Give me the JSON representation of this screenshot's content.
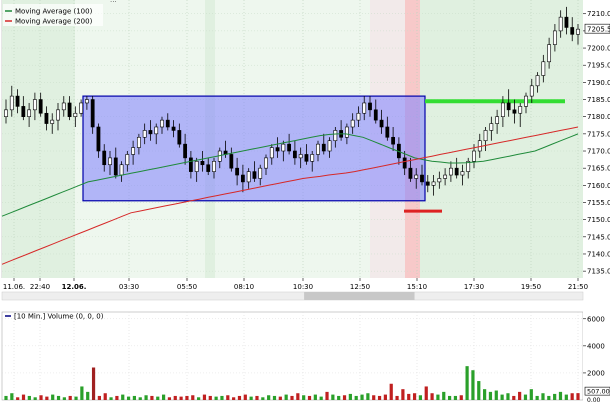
{
  "chart_data": [
    {
      "type": "candlestick",
      "title": "",
      "legend": [
        {
          "label": "Moving Average (100)",
          "color": "#1f8a3a"
        },
        {
          "label": "Moving Average (200)",
          "color": "#d62828"
        }
      ],
      "top_clipped_label": "...",
      "x_tick_labels": [
        "11.06.",
        "22:40",
        "12.06.",
        "03:30",
        "05:50",
        "08:10",
        "10:30",
        "12:50",
        "15:10",
        "17:30",
        "19:50",
        "21:50"
      ],
      "y_tick_labels": [
        "7135.00",
        "7140.00",
        "7145.00",
        "7150.00",
        "7155.00",
        "7160.00",
        "7165.00",
        "7170.00",
        "7175.00",
        "7180.00",
        "7185.00",
        "7190.00",
        "7195.00",
        "7200.00",
        "7205.00",
        "7210.00"
      ],
      "ylim": [
        7133,
        7214
      ],
      "last_price_label": "7205.5",
      "candles": [
        [
          7180,
          7185,
          7178,
          7182
        ],
        [
          7182,
          7189,
          7180,
          7186
        ],
        [
          7186,
          7188,
          7181,
          7183
        ],
        [
          7183,
          7186,
          7179,
          7180
        ],
        [
          7180,
          7184,
          7177,
          7182
        ],
        [
          7182,
          7187,
          7179,
          7185
        ],
        [
          7185,
          7187,
          7180,
          7181
        ],
        [
          7181,
          7183,
          7176,
          7178
        ],
        [
          7178,
          7181,
          7175,
          7179
        ],
        [
          7179,
          7184,
          7176,
          7182
        ],
        [
          7182,
          7186,
          7180,
          7184
        ],
        [
          7184,
          7186,
          7179,
          7180
        ],
        [
          7180,
          7183,
          7177,
          7181
        ],
        [
          7181,
          7185,
          7180,
          7184
        ],
        [
          7184,
          7186,
          7182,
          7185
        ],
        [
          7185,
          7186,
          7175,
          7177
        ],
        [
          7177,
          7178,
          7168,
          7170
        ],
        [
          7170,
          7172,
          7164,
          7166
        ],
        [
          7166,
          7170,
          7163,
          7168
        ],
        [
          7168,
          7171,
          7162,
          7163
        ],
        [
          7163,
          7167,
          7161,
          7166
        ],
        [
          7166,
          7170,
          7164,
          7169
        ],
        [
          7169,
          7173,
          7166,
          7171
        ],
        [
          7171,
          7175,
          7169,
          7174
        ],
        [
          7174,
          7178,
          7172,
          7176
        ],
        [
          7176,
          7179,
          7173,
          7175
        ],
        [
          7175,
          7178,
          7172,
          7177
        ],
        [
          7177,
          7180,
          7175,
          7179
        ],
        [
          7179,
          7181,
          7176,
          7177
        ],
        [
          7177,
          7179,
          7174,
          7176
        ],
        [
          7176,
          7178,
          7171,
          7172
        ],
        [
          7172,
          7175,
          7166,
          7168
        ],
        [
          7168,
          7170,
          7162,
          7164
        ],
        [
          7164,
          7168,
          7161,
          7167
        ],
        [
          7167,
          7170,
          7164,
          7166
        ],
        [
          7166,
          7168,
          7163,
          7164
        ],
        [
          7164,
          7168,
          7162,
          7167
        ],
        [
          7167,
          7171,
          7165,
          7170
        ],
        [
          7170,
          7173,
          7168,
          7169
        ],
        [
          7169,
          7171,
          7164,
          7165
        ],
        [
          7165,
          7168,
          7160,
          7163
        ],
        [
          7163,
          7166,
          7158,
          7161
        ],
        [
          7161,
          7165,
          7159,
          7164
        ],
        [
          7164,
          7167,
          7161,
          7162
        ],
        [
          7162,
          7166,
          7160,
          7165
        ],
        [
          7165,
          7169,
          7163,
          7168
        ],
        [
          7168,
          7172,
          7166,
          7171
        ],
        [
          7171,
          7174,
          7168,
          7170
        ],
        [
          7170,
          7173,
          7167,
          7172
        ],
        [
          7172,
          7175,
          7169,
          7170
        ],
        [
          7170,
          7173,
          7166,
          7168
        ],
        [
          7168,
          7171,
          7165,
          7169
        ],
        [
          7169,
          7172,
          7166,
          7167
        ],
        [
          7167,
          7170,
          7164,
          7169
        ],
        [
          7169,
          7173,
          7167,
          7172
        ],
        [
          7172,
          7175,
          7169,
          7170
        ],
        [
          7170,
          7174,
          7168,
          7173
        ],
        [
          7173,
          7177,
          7171,
          7176
        ],
        [
          7176,
          7179,
          7173,
          7174
        ],
        [
          7174,
          7178,
          7172,
          7177
        ],
        [
          7177,
          7181,
          7175,
          7179
        ],
        [
          7179,
          7183,
          7177,
          7181
        ],
        [
          7181,
          7186,
          7179,
          7184
        ],
        [
          7184,
          7186,
          7180,
          7182
        ],
        [
          7182,
          7185,
          7178,
          7179
        ],
        [
          7179,
          7182,
          7175,
          7177
        ],
        [
          7177,
          7180,
          7173,
          7174
        ],
        [
          7174,
          7177,
          7170,
          7172
        ],
        [
          7172,
          7174,
          7166,
          7168
        ],
        [
          7168,
          7170,
          7163,
          7165
        ],
        [
          7165,
          7168,
          7161,
          7162
        ],
        [
          7162,
          7165,
          7159,
          7163
        ],
        [
          7163,
          7166,
          7160,
          7161
        ],
        [
          7161,
          7163,
          7158,
          7160
        ],
        [
          7160,
          7163,
          7157,
          7161
        ],
        [
          7161,
          7164,
          7159,
          7162
        ],
        [
          7162,
          7165,
          7160,
          7163
        ],
        [
          7163,
          7167,
          7161,
          7165
        ],
        [
          7165,
          7168,
          7162,
          7163
        ],
        [
          7163,
          7166,
          7160,
          7164
        ],
        [
          7164,
          7168,
          7162,
          7167
        ],
        [
          7167,
          7172,
          7165,
          7170
        ],
        [
          7170,
          7175,
          7168,
          7173
        ],
        [
          7173,
          7177,
          7170,
          7176
        ],
        [
          7176,
          7180,
          7173,
          7178
        ],
        [
          7178,
          7182,
          7175,
          7180
        ],
        [
          7180,
          7186,
          7177,
          7184
        ],
        [
          7184,
          7188,
          7180,
          7182
        ],
        [
          7182,
          7185,
          7178,
          7181
        ],
        [
          7181,
          7184,
          7177,
          7183
        ],
        [
          7183,
          7187,
          7181,
          7186
        ],
        [
          7186,
          7191,
          7184,
          7189
        ],
        [
          7189,
          7193,
          7187,
          7192
        ],
        [
          7192,
          7198,
          7190,
          7196
        ],
        [
          7196,
          7203,
          7194,
          7201
        ],
        [
          7201,
          7207,
          7199,
          7205
        ],
        [
          7205,
          7211,
          7203,
          7209
        ],
        [
          7209,
          7212,
          7204,
          7206
        ],
        [
          7206,
          7209,
          7202,
          7204
        ],
        [
          7204,
          7207,
          7201,
          7205.5
        ]
      ],
      "ma_100": [
        7151,
        7152,
        7153,
        7154,
        7155,
        7156,
        7157,
        7158,
        7159,
        7160,
        7161,
        7161.5,
        7162,
        7162.5,
        7163,
        7163.5,
        7164,
        7164.5,
        7165,
        7165.5,
        7166,
        7166.5,
        7167,
        7167.5,
        7168,
        7168.5,
        7169,
        7169.5,
        7170,
        7170.5,
        7171,
        7171.5,
        7172,
        7172.5,
        7173,
        7173.5,
        7174,
        7174.5,
        7174.8,
        7175,
        7175,
        7174.5,
        7174,
        7173,
        7172,
        7171,
        7170,
        7169,
        7168,
        7167.5,
        7167,
        7166.8,
        7166.5,
        7166.5,
        7166.6,
        7166.8,
        7167,
        7167.5,
        7168,
        7168.5,
        7169,
        7169.5,
        7170,
        7171,
        7172,
        7173,
        7174,
        7175
      ],
      "ma_200": [
        7137,
        7138,
        7139,
        7140,
        7141,
        7142,
        7143,
        7144,
        7145,
        7146,
        7147,
        7148,
        7149,
        7150,
        7151,
        7152,
        7152.5,
        7153,
        7153.5,
        7154,
        7154.5,
        7155,
        7155.5,
        7156,
        7156.5,
        7157,
        7157.5,
        7158,
        7158.5,
        7159,
        7159.5,
        7160,
        7160.5,
        7161,
        7161.5,
        7162,
        7162.3,
        7162.6,
        7163,
        7163.3,
        7163.6,
        7164,
        7164.5,
        7165,
        7165.5,
        7166,
        7166.5,
        7167,
        7167.5,
        7168,
        7168.5,
        7169,
        7169.5,
        7170,
        7170.5,
        7171,
        7171.5,
        7172,
        7172.5,
        7173,
        7173.5,
        7174,
        7174.5,
        7175,
        7175.5,
        7176,
        7176.5,
        7177
      ]
    },
    {
      "type": "bar",
      "title": "",
      "legend": [
        {
          "label": "[10 Min.] Volume  (0, 0, 0)",
          "color": "#000080"
        }
      ],
      "y_tick_labels": [
        "2000",
        "4000",
        "6000"
      ],
      "last_value_label": "507.00",
      "bottom_label": "0.00",
      "ylim": [
        0,
        6500
      ],
      "values": [
        300,
        500,
        200,
        400,
        300,
        200,
        350,
        250,
        400,
        300,
        200,
        300,
        250,
        1000,
        600,
        2400,
        300,
        500,
        200,
        300,
        400,
        250,
        300,
        200,
        350,
        300,
        250,
        400,
        200,
        300,
        250,
        300,
        350,
        200,
        400,
        300,
        250,
        300,
        350,
        200,
        300,
        400,
        250,
        300,
        200,
        350,
        300,
        250,
        400,
        300,
        500,
        350,
        300,
        400,
        250,
        600,
        400,
        300,
        350,
        450,
        300,
        400,
        500,
        350,
        300,
        400,
        1200,
        300,
        800,
        450,
        500,
        350,
        1000,
        500,
        400,
        600,
        300,
        300,
        350,
        2500,
        2200,
        1400,
        800,
        600,
        700,
        400,
        500,
        300,
        600,
        400,
        800,
        300,
        500,
        300,
        450,
        600,
        400,
        500,
        507
      ],
      "bar_colors": "green/red"
    }
  ],
  "background": {
    "plot": "#e0f0e0",
    "shade_light": "#eef7ee",
    "box_fill": "#8080ff",
    "box_border": "#0000aa",
    "green_marker": "#33dd33",
    "red_marker": "#dd2222"
  },
  "scrollbar": {
    "thumb_fraction_start": 0.52,
    "thumb_fraction_end": 0.71
  }
}
